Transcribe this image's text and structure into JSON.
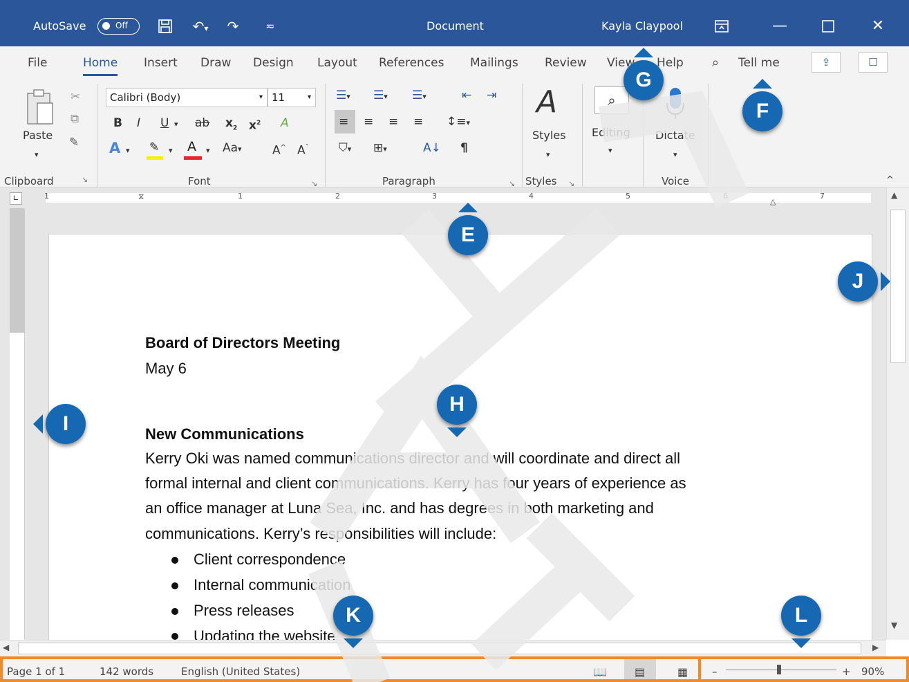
{
  "titlebar": {
    "autosave_label": "AutoSave",
    "autosave_state": "Off",
    "doc_title": "Document",
    "user_name": "Kayla Claypool"
  },
  "tabs": [
    "File",
    "Home",
    "Insert",
    "Draw",
    "Design",
    "Layout",
    "References",
    "Mailings",
    "Review",
    "View",
    "Help"
  ],
  "tell_me": "Tell me",
  "ribbon": {
    "paste": "Paste",
    "font_name": "Calibri (Body)",
    "font_size": "11",
    "styles": "Styles",
    "editing": "Editing",
    "dictate": "Dictate",
    "groups": [
      "Clipboard",
      "Font",
      "Paragraph",
      "Styles",
      "Voice"
    ]
  },
  "ruler_numbers": [
    "1",
    "1",
    "2",
    "3",
    "4",
    "5",
    "6",
    "7"
  ],
  "document": {
    "heading": "Board of Directors Meeting",
    "date": "May 6",
    "section": "New Communications",
    "paragraph": [
      "Kerry Oki was named communications director and will coordinate and direct all",
      "formal internal and client communications. Kerry has four years of experience as",
      "an office manager at Luna Sea, Inc. and has degrees in both marketing and",
      "communications. Kerry’s responsibilities will include:"
    ],
    "bullets": [
      "Client correspondence",
      "Internal communication",
      "Press releases",
      "Updating the website"
    ]
  },
  "status": {
    "page": "Page 1 of 1",
    "words": "142 words",
    "language": "English (United States)",
    "zoom": "90%"
  },
  "callouts": [
    "E",
    "F",
    "G",
    "H",
    "I",
    "J",
    "K",
    "L"
  ],
  "colors": {
    "title_bar": "#2b579a",
    "callout": "#1768b3",
    "status_highlight": "#ef8b2c"
  }
}
